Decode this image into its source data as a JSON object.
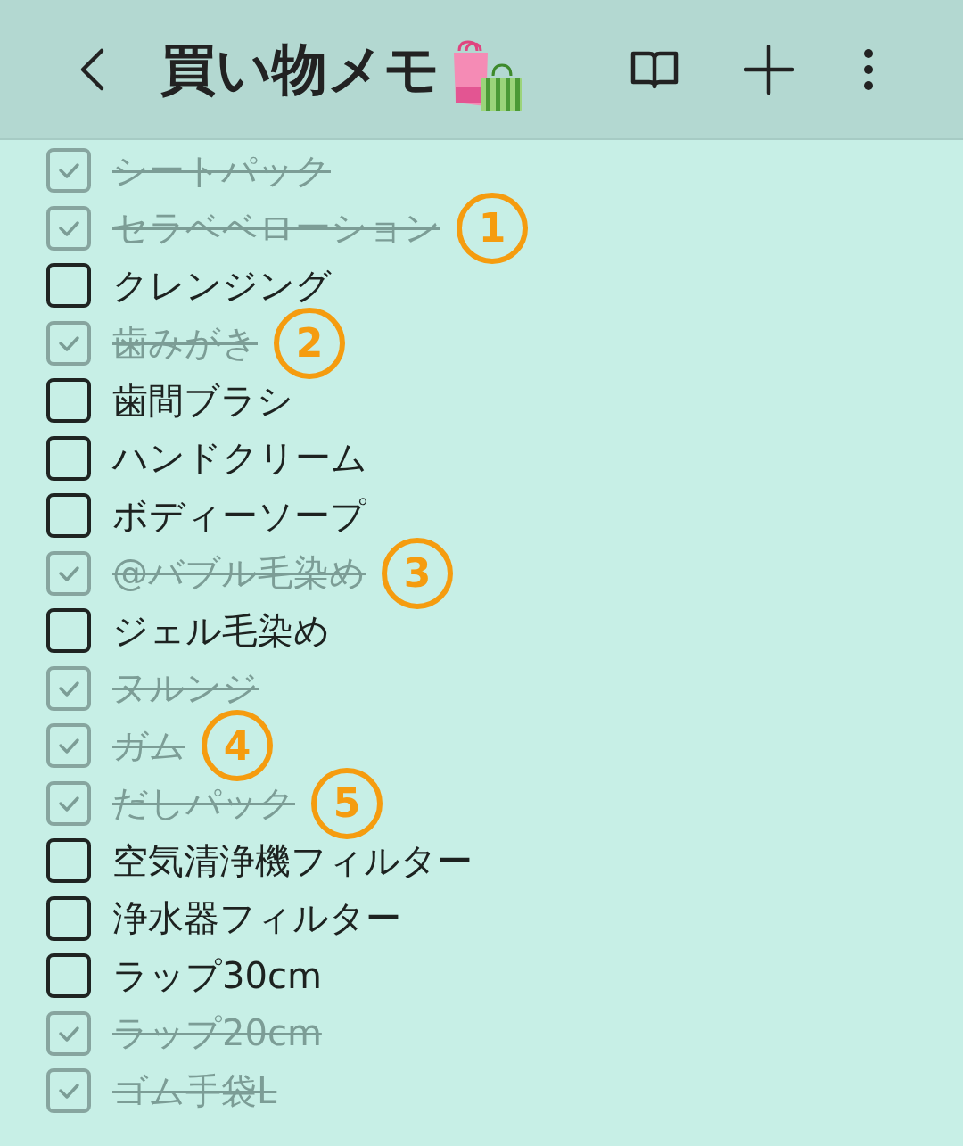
{
  "header": {
    "title": "買い物メモ"
  },
  "items": [
    {
      "text": "シートパック",
      "checked": true
    },
    {
      "text": "セラベベローション",
      "checked": true,
      "marker": "1"
    },
    {
      "text": "クレンジング",
      "checked": false
    },
    {
      "text": "歯みがき",
      "checked": true,
      "marker": "2"
    },
    {
      "text": "歯間ブラシ",
      "checked": false
    },
    {
      "text": "ハンドクリーム",
      "checked": false
    },
    {
      "text": "ボディーソープ",
      "checked": false
    },
    {
      "text": "@バブル毛染め",
      "checked": true,
      "marker": "3"
    },
    {
      "text": "ジェル毛染め",
      "checked": false
    },
    {
      "text": "ヌルンジ",
      "checked": true
    },
    {
      "text": "ガム",
      "checked": true,
      "marker": "4"
    },
    {
      "text": "だしパック",
      "checked": true,
      "marker": "5"
    },
    {
      "text": "空気清浄機フィルター",
      "checked": false
    },
    {
      "text": "浄水器フィルター",
      "checked": false
    },
    {
      "text": "ラップ30cm",
      "checked": false
    },
    {
      "text": "ラップ20cm",
      "checked": true
    },
    {
      "text": "ゴム手袋L",
      "checked": true
    }
  ]
}
